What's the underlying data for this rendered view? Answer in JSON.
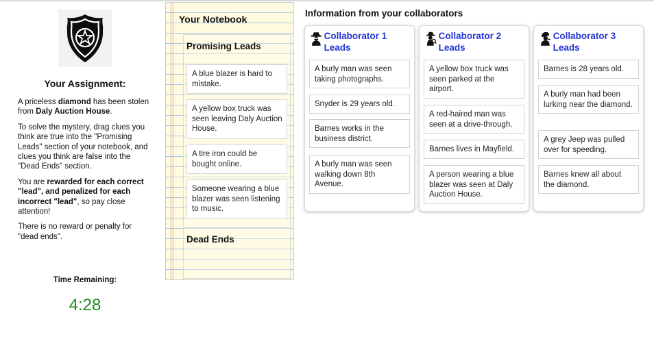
{
  "assignment": {
    "title": "Your Assignment:",
    "p1_a": "A priceless ",
    "p1_b": "diamond",
    "p1_c": " has been stolen from ",
    "p1_d": "Daly Auction House",
    "p1_e": ".",
    "p2": "To solve the mystery, drag clues you think are true into the \"Promising Leads\" section of your notebook, and clues you think are false into the \"Dead Ends\" section.",
    "p3_a": "You are ",
    "p3_b": "rewarded for each correct \"lead\", and penalized for each incorrect \"lead\"",
    "p3_c": ", so pay close attention!",
    "p4": "There is no reward or penalty for \"dead ends\"."
  },
  "timer": {
    "label": "Time Remaining:",
    "value": "4:28",
    "color": "#1e8a1e"
  },
  "notebook": {
    "title": "Your Notebook",
    "promising_title": "Promising Leads",
    "dead_ends_title": "Dead Ends",
    "promising_leads": [
      "A blue blazer is hard to mistake.",
      "A yellow box truck was seen leaving Daly Auction House.",
      "A tire iron could be bought online.",
      "Someone wearing a blue blazer was seen listening to music."
    ]
  },
  "collaborators": {
    "heading": "Information from your collaborators",
    "accent_color": "#2433d6",
    "cards": [
      {
        "title": "Collaborator 1 Leads",
        "icon": "spy-icon",
        "leads": [
          "A burly man was seen taking photographs.",
          "Snyder is 29 years old.",
          "Barnes works in the business district.",
          "A burly man was seen walking down 8th Avenue."
        ]
      },
      {
        "title": "Collaborator 2 Leads",
        "icon": "detective-icon",
        "leads": [
          "A yellow box truck was seen parked at the airport.",
          "A red-haired man was seen at a drive-through.",
          "Barnes lives in Mayfield.",
          "A person wearing a blue blazer was seen at Daly Auction House."
        ]
      },
      {
        "title": "Collaborator 3 Leads",
        "icon": "sherlock-icon",
        "leads": [
          "Barnes is 28 years old.",
          "A burly man had been lurking near the diamond.",
          "A grey Jeep was pulled over for speeding.",
          "Barnes knew all about the diamond."
        ]
      }
    ]
  }
}
